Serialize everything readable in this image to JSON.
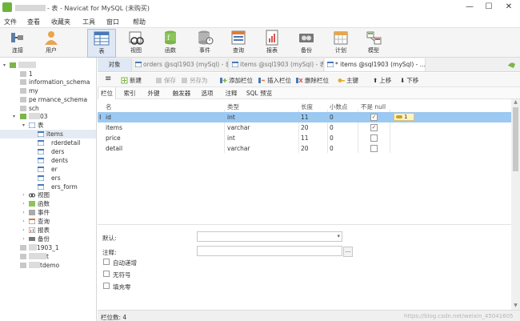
{
  "window": {
    "title": "- 表 - Navicat for MySQL (未购买)",
    "controls": {
      "minimize": "—",
      "maximize": "☐",
      "close": "✕"
    }
  },
  "menu": [
    "文件",
    "查看",
    "收藏夹",
    "工具",
    "窗口",
    "帮助"
  ],
  "toolbar": [
    {
      "label": "连接",
      "icon": "connect-icon"
    },
    {
      "label": "用户",
      "icon": "user-icon"
    },
    {
      "label": "表",
      "icon": "table-icon",
      "active": true
    },
    {
      "label": "视图",
      "icon": "view-icon"
    },
    {
      "label": "函数",
      "icon": "function-icon"
    },
    {
      "label": "事件",
      "icon": "event-icon"
    },
    {
      "label": "查询",
      "icon": "query-icon"
    },
    {
      "label": "报表",
      "icon": "report-icon"
    },
    {
      "label": "备份",
      "icon": "backup-icon"
    },
    {
      "label": "计划",
      "icon": "schedule-icon"
    },
    {
      "label": "模型",
      "icon": "model-icon"
    }
  ],
  "sidebar": {
    "tree": [
      {
        "label": "",
        "blur_width": 22
      },
      {
        "label": "1"
      },
      {
        "label": "information_schema"
      },
      {
        "label": "my"
      },
      {
        "label": "pe      rmance_schema"
      },
      {
        "label": "sch"
      },
      {
        "label": "03"
      },
      {
        "label": "表"
      },
      {
        "label": "items"
      },
      {
        "label": "rderdetail"
      },
      {
        "label": "ders"
      },
      {
        "label": "dents"
      },
      {
        "label": "er"
      },
      {
        "label": "ers"
      },
      {
        "label": "ers_form"
      },
      {
        "label": "视图"
      },
      {
        "label": "函数"
      },
      {
        "label": "事件"
      },
      {
        "label": "查询"
      },
      {
        "label": "报表"
      },
      {
        "label": "备份"
      },
      {
        "label": "1903_1"
      },
      {
        "label": "t"
      },
      {
        "label": "tdemo"
      }
    ]
  },
  "tabs": {
    "objects": "对象",
    "tab1": "orders @sql1903 (mySql) - 表",
    "tab2": "items @sql1903 (mySql) - 表",
    "tab3": "* items @sql1903 (mySql) - ..."
  },
  "subtoolbar": {
    "menu_icon": "≡",
    "new": "新建",
    "save": "保存",
    "save_as": "另存为",
    "add_field": "添加栏位",
    "insert_field": "插入栏位",
    "delete_field": "删除栏位",
    "primary_key": "主键",
    "move_up": "上移",
    "move_down": "下移"
  },
  "subtabs": [
    "栏位",
    "索引",
    "外键",
    "触发器",
    "选项",
    "注释",
    "SQL 预览"
  ],
  "grid": {
    "headers": {
      "name": "名",
      "type": "类型",
      "length": "长度",
      "decimals": "小数点",
      "not_null": "不是 null"
    },
    "rows": [
      {
        "name": "id",
        "type": "int",
        "length": "11",
        "decimals": "0",
        "not_null": true,
        "key": "1"
      },
      {
        "name": "items",
        "type": "varchar",
        "length": "20",
        "decimals": "0",
        "not_null": true
      },
      {
        "name": "price",
        "type": "int",
        "length": "11",
        "decimals": "0",
        "not_null": false
      },
      {
        "name": "detail",
        "type": "varchar",
        "length": "20",
        "decimals": "0",
        "not_null": false
      }
    ]
  },
  "props": {
    "default_label": "默认:",
    "comment_label": "注释:",
    "ellipsis": "...",
    "auto_increment": "自动递增",
    "unsigned": "无符号",
    "zerofill": "填充零"
  },
  "status": {
    "fields": "栏位数: 4",
    "watermark": "https://blog.csdn.net/weixin_45041605"
  },
  "colors": {
    "selected_row": "#9cc9f2",
    "active_tool": "#dfe8f4"
  }
}
